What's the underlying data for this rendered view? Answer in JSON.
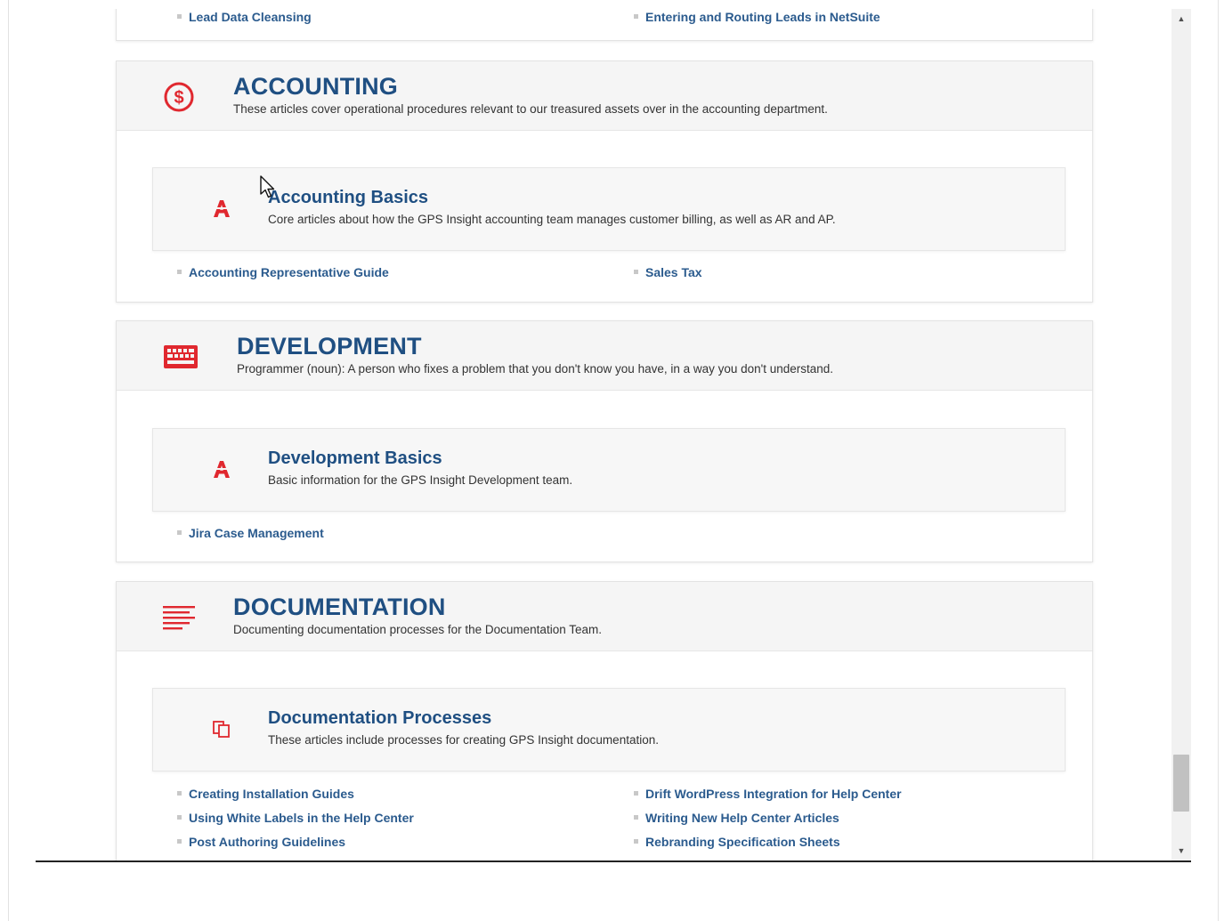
{
  "top_links": {
    "left": "Lead Data Cleansing",
    "right": "Entering and Routing Leads in NetSuite"
  },
  "categories": [
    {
      "icon": "dollar-circle-icon",
      "title": "ACCOUNTING",
      "description": "These articles cover operational procedures relevant to our treasured assets over in the accounting department.",
      "section": {
        "icon": "letter-a-icon",
        "title": "Accounting Basics",
        "description": "Core articles about how the GPS Insight accounting team manages customer billing, as well as AR and AP."
      },
      "links": [
        "Accounting Representative Guide",
        "Sales Tax"
      ]
    },
    {
      "icon": "keyboard-icon",
      "title": "DEVELOPMENT",
      "description": "Programmer (noun): A person who fixes a problem that you don't know you have, in a way you don't understand.",
      "section": {
        "icon": "letter-a-icon",
        "title": "Development Basics",
        "description": "Basic information for the GPS Insight Development team."
      },
      "links": [
        "Jira Case Management"
      ]
    },
    {
      "icon": "align-left-icon",
      "title": "DOCUMENTATION",
      "description": "Documenting documentation processes for the Documentation Team.",
      "section": {
        "icon": "copy-icon",
        "title": "Documentation Processes",
        "description": "These articles include processes for creating GPS Insight documentation."
      },
      "links": [
        "Creating Installation Guides",
        "Drift WordPress Integration for Help Center",
        "Using White Labels in the Help Center",
        "Writing New Help Center Articles",
        "Post Authoring Guidelines",
        "Rebranding Specification Sheets"
      ]
    }
  ],
  "colors": {
    "accent": "#1f4f82",
    "link": "#2b5b8e",
    "icon_red": "#e0282f"
  },
  "scrollbar": {
    "up_arrow": "▲",
    "down_arrow": "▼"
  }
}
